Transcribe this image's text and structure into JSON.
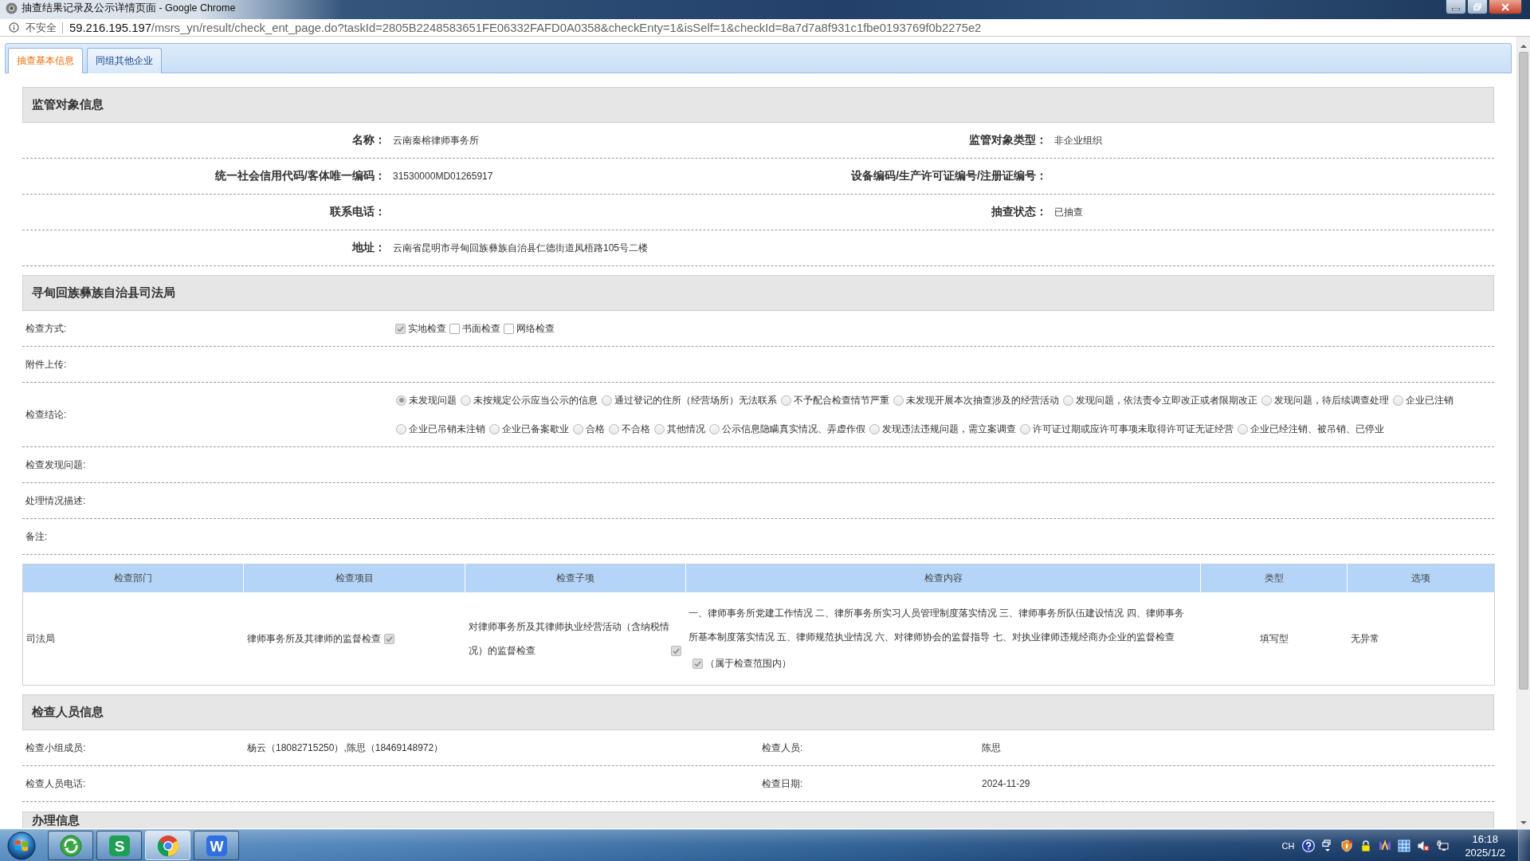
{
  "window": {
    "title": "抽查结果记录及公示详情页面 - Google Chrome"
  },
  "address_bar": {
    "security": "不安全",
    "host": "59.216.195.197",
    "path": "/msrs_yn/result/check_ent_page.do?taskId=2805B2248583651FE06332FAFD0A0358&checkEnty=1&isSelf=1&checkId=8a7d7a8f931c1fbe0193769f0b2275e2"
  },
  "tabs": [
    {
      "label": "抽查基本信息",
      "selected": true
    },
    {
      "label": "同组其他企业",
      "selected": false
    }
  ],
  "subject_info": {
    "title": "监管对象信息",
    "rows": [
      {
        "fields": [
          {
            "label": "名称：",
            "value": "云南秦榕律师事务所"
          },
          {
            "label": "监管对象类型：",
            "value": "非企业组织"
          }
        ]
      },
      {
        "fields": [
          {
            "label": "统一社会信用代码/客体唯一编码：",
            "value": "31530000MD01265917"
          },
          {
            "label": "设备编码/生产许可证编号/注册证编号："
          }
        ]
      },
      {
        "fields": [
          {
            "label": "联系电话："
          },
          {
            "label": "抽查状态：",
            "value": "已抽查"
          }
        ]
      },
      {
        "fields": [
          {
            "label": "地址：",
            "value": "云南省昆明市寻甸回族彝族自治县仁德街道凤梧路105号二楼"
          }
        ]
      }
    ]
  },
  "inspection": {
    "title": "寻甸回族彝族自治县司法局",
    "rows": [
      {
        "kind": "checkboxes",
        "label": "检查方式:",
        "options": [
          {
            "label": "实地检查",
            "checked": true
          },
          {
            "label": "书面检查",
            "checked": false
          },
          {
            "label": "网络检查",
            "checked": false
          }
        ]
      },
      {
        "kind": "text",
        "label": "附件上传:"
      },
      {
        "kind": "radios",
        "label": "检查结论:",
        "options": [
          {
            "label": "未发现问题",
            "selected": true
          },
          {
            "label": "未按规定公示应当公示的信息",
            "selected": false
          },
          {
            "label": "通过登记的住所（经营场所）无法联系",
            "selected": false
          },
          {
            "label": "不予配合检查情节严重",
            "selected": false
          },
          {
            "label": "未发现开展本次抽查涉及的经营活动",
            "selected": false
          },
          {
            "label": "发现问题，依法责令立即改正或者限期改正",
            "selected": false
          },
          {
            "label": "发现问题，待后续调查处理",
            "selected": false
          },
          {
            "label": "企业已注销",
            "selected": false
          },
          {
            "label": "企业已吊销未注销",
            "selected": false
          },
          {
            "label": "企业已备案歇业",
            "selected": false
          },
          {
            "label": "合格",
            "selected": false
          },
          {
            "label": "不合格",
            "selected": false
          },
          {
            "label": "其他情况",
            "selected": false
          },
          {
            "label": "公示信息隐瞒真实情况、弄虚作假",
            "selected": false
          },
          {
            "label": "发现违法违规问题，需立案调查",
            "selected": false
          },
          {
            "label": "许可证过期或应许可事项未取得许可证无证经营",
            "selected": false
          },
          {
            "label": "企业已经注销、被吊销、已停业",
            "selected": false
          }
        ]
      },
      {
        "kind": "text",
        "label": "检查发现问题:"
      },
      {
        "kind": "text",
        "label": "处理情况描述:"
      },
      {
        "kind": "text",
        "label": "备注:"
      }
    ],
    "table": {
      "columns": [
        "检查部门",
        "检查项目",
        "检查子项",
        "检查内容",
        "类型",
        "选项"
      ],
      "rows": [
        {
          "department": "司法局",
          "item": "律师事务所及其律师的监督检查",
          "item_checked": true,
          "sub_item": "对律师事务所及其律师执业经营活动（含纳税情况）的监督检查",
          "sub_item_checked": true,
          "content": "一、律师事务所党建工作情况 二、律所事务所实习人员管理制度落实情况 三、律师事务所队伍建设情况 四、律师事务所基本制度落实情况 五、律师规范执业情况 六、对律师协会的监督指导 七、对执业律师违规经商办企业的监督检查",
          "scope_checked": true,
          "scope_note": "（属于检查范围内）",
          "type": "填写型",
          "option": "无异常"
        }
      ]
    }
  },
  "inspectors": {
    "title": "检查人员信息",
    "rows": [
      {
        "fields": [
          {
            "label": "检查小组成员:",
            "value": "杨云（18082715250）,陈思（18469148972）"
          },
          {
            "label": "检查人员:",
            "value": "陈思"
          }
        ]
      },
      {
        "fields": [
          {
            "label": "检查人员电话:"
          },
          {
            "label": "检查日期:",
            "value": "2024-11-29"
          }
        ]
      }
    ]
  },
  "handling": {
    "title": "办理信息"
  },
  "taskbar": {
    "apps": [
      {
        "kind": "arrows",
        "active": false
      },
      {
        "kind": "sheet",
        "glyph": "S",
        "active": false
      },
      {
        "kind": "browser",
        "active": true
      },
      {
        "kind": "writer",
        "glyph": "W",
        "active": false
      }
    ],
    "tray": {
      "language": "CH",
      "time": "16:18",
      "date": "2025/1/2"
    }
  }
}
